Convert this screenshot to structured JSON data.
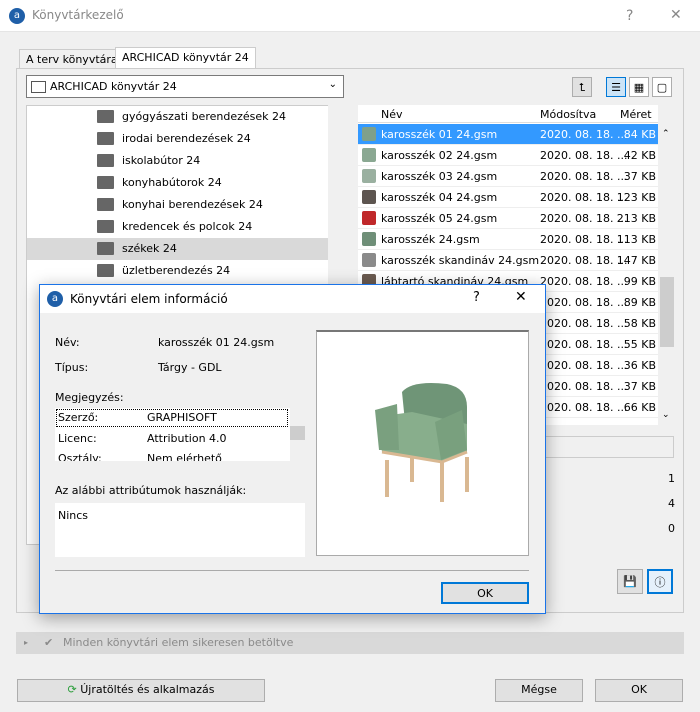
{
  "window": {
    "title": "Könyvtárkezelő",
    "help": "?",
    "close": "✕"
  },
  "tabs": [
    {
      "label": "A terv könyvtárai"
    },
    {
      "label": "ARCHICAD könyvtár 24"
    }
  ],
  "library_select": {
    "value": "ARCHICAD könyvtár 24"
  },
  "tree": [
    {
      "label": "gyógyászati berendezések 24"
    },
    {
      "label": "irodai berendezések 24"
    },
    {
      "label": "iskolabútor 24"
    },
    {
      "label": "konyhabútorok 24"
    },
    {
      "label": "konyhai berendezések 24"
    },
    {
      "label": "kredencek és polcok 24"
    },
    {
      "label": "székek 24",
      "selected": true
    },
    {
      "label": "üzletberendezés 24"
    }
  ],
  "list": {
    "headers": {
      "name": "Név",
      "modified": "Módosítva",
      "size": "Méret"
    },
    "rows": [
      {
        "name": "karosszék 01 24.gsm",
        "modified": "2020. 08. 18. ...",
        "size": "84 KB",
        "selected": true,
        "color": "#7fa08a"
      },
      {
        "name": "karosszék 02 24.gsm",
        "modified": "2020. 08. 18. ...",
        "size": "42 KB",
        "color": "#8aa892"
      },
      {
        "name": "karosszék 03 24.gsm",
        "modified": "2020. 08. 18. ...",
        "size": "37 KB",
        "color": "#9ab0a0"
      },
      {
        "name": "karosszék 04 24.gsm",
        "modified": "2020. 08. 18. ...",
        "size": "123 KB",
        "color": "#5d5550"
      },
      {
        "name": "karosszék 05 24.gsm",
        "modified": "2020. 08. 18. ...",
        "size": "213 KB",
        "color": "#c0282a"
      },
      {
        "name": "karosszék 24.gsm",
        "modified": "2020. 08. 18. ...",
        "size": "113 KB",
        "color": "#6f8f78"
      },
      {
        "name": "karosszék skandináv 24.gsm",
        "modified": "2020. 08. 18. ...",
        "size": "147 KB",
        "color": "#8a8a8a"
      },
      {
        "name": "lábtartó skandináv 24.gsm",
        "modified": "2020. 08. 18. ...",
        "size": "99 KB",
        "color": "#6a5a50"
      },
      {
        "name": "",
        "modified": "2020. 08. 18. ...",
        "size": "89 KB"
      },
      {
        "name": "",
        "modified": "2020. 08. 18. ...",
        "size": "58 KB"
      },
      {
        "name": "",
        "modified": "2020. 08. 18. ...",
        "size": "55 KB"
      },
      {
        "name": "",
        "modified": "2020. 08. 18. ...",
        "size": "36 KB"
      },
      {
        "name": "",
        "modified": "2020. 08. 18. ...",
        "size": "37 KB"
      },
      {
        "name": "",
        "modified": "2020. 08. 18. ...",
        "size": "66 KB"
      }
    ]
  },
  "counts": [
    "1",
    "4",
    "0"
  ],
  "status": {
    "text": "Minden könyvtári elem sikeresen betöltve"
  },
  "footer": {
    "reload": "Újratöltés és alkalmazás",
    "cancel": "Mégse",
    "ok": "OK"
  },
  "dialog": {
    "title": "Könyvtári elem információ",
    "help": "?",
    "close": "✕",
    "name_label": "Név:",
    "name_value": "karosszék 01 24.gsm",
    "type_label": "Típus:",
    "type_value": "Tárgy - GDL",
    "notes_label": "Megjegyzés:",
    "notes": [
      {
        "k": "Szerző:",
        "v": "GRAPHISOFT"
      },
      {
        "k": "Licenc:",
        "v": "Attribution 4.0"
      },
      {
        "k": "Osztály:",
        "v": "Nem elérhető"
      }
    ],
    "used_by_label": "Az alábbi attribútumok használják:",
    "used_by_value": "Nincs",
    "ok": "OK"
  }
}
